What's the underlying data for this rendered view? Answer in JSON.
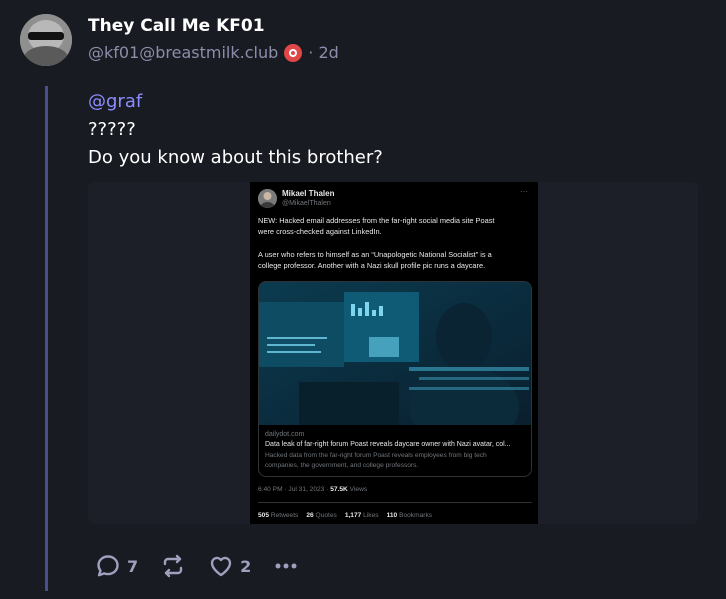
{
  "post": {
    "display_name": "They Call Me KF01",
    "handle": "@kf01@breastmilk.club",
    "time_ago": "· 2d",
    "content": {
      "mention": "@graf",
      "line1": "?????",
      "line2": "Do you know about this brother?"
    }
  },
  "embedded_tweet": {
    "author_name": "Mikael Thalen",
    "author_handle": "@MikaelThalen",
    "more": "···",
    "paragraph1": [
      "NEW: Hacked email addresses from the far-right social media site Poast",
      "were cross-checked against LinkedIn."
    ],
    "paragraph2": [
      "A user who refers to himself as an “Unapologetic National Socialist” is a",
      "college professor. Another with a Nazi skull profile pic runs a daycare."
    ],
    "card": {
      "domain": "dailydot.com",
      "title": "Data leak of far-right forum Poast reveals daycare owner with Nazi avatar, col...",
      "description": [
        "Hacked data from the far-right forum Poast reveals employees from big tech",
        "companies, the government, and college professors."
      ]
    },
    "timestamp": "6:40 PM · Jul 31, 2023 ·",
    "views_count": "57.5K",
    "views_label": "Views",
    "stats": [
      {
        "count": "505",
        "label": "Retweets"
      },
      {
        "count": "26",
        "label": "Quotes"
      },
      {
        "count": "1,177",
        "label": "Likes"
      },
      {
        "count": "110",
        "label": "Bookmarks"
      }
    ]
  },
  "actions": {
    "reply_icon": "reply-icon",
    "reply_count": "7",
    "boost_icon": "boost-icon",
    "favourite_icon": "heart-icon",
    "favourite_count": "2",
    "more_icon": "more-icon"
  },
  "colors": {
    "background": "#191b22",
    "mention": "#8c8dff",
    "thread_line": "#4a4e8e",
    "muted": "#8c8daa"
  }
}
